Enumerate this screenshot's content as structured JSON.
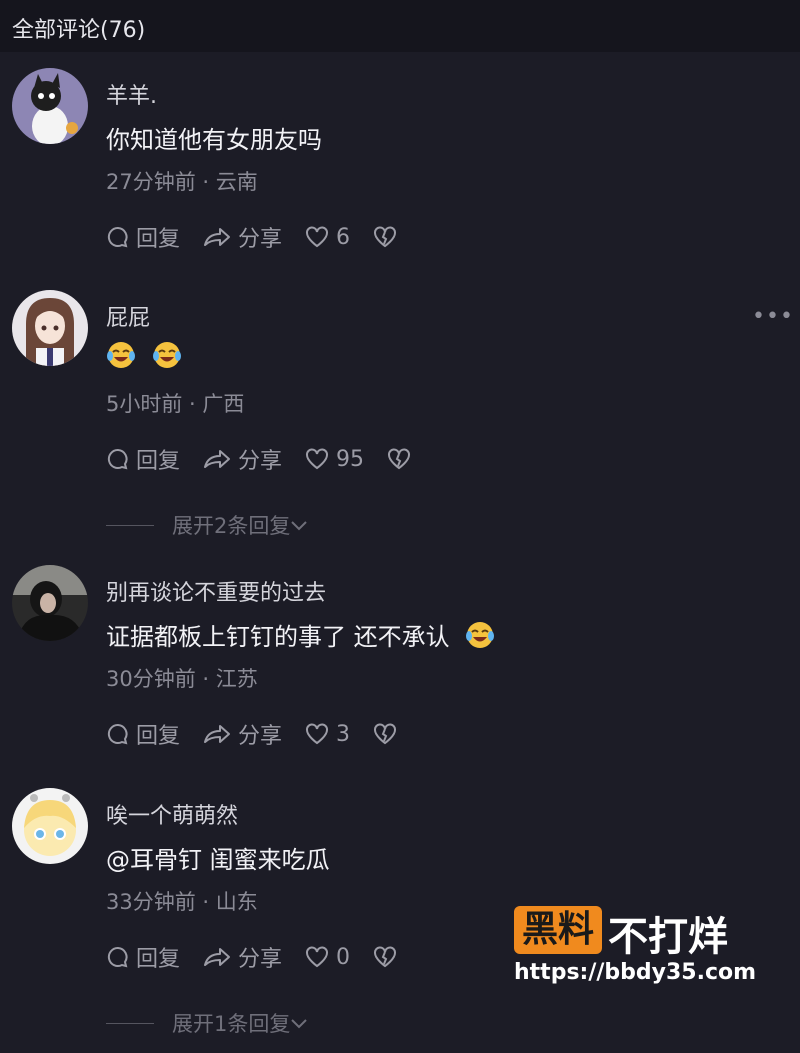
{
  "header": {
    "title": "全部评论(76)"
  },
  "actions_labels": {
    "reply": "回复",
    "share": "分享"
  },
  "comments": [
    {
      "name": "羊羊.",
      "text": "你知道他有女朋友吗",
      "meta": "27分钟前 · 云南",
      "likes": "6",
      "avatar": "cat-cartoon-avatar"
    },
    {
      "name": "屁屁",
      "text": "",
      "emojis": [
        "laugh-cry-emoji",
        "laugh-cry-emoji"
      ],
      "meta": "5小时前 · 广西",
      "likes": "95",
      "more": "•••",
      "expand": "展开2条回复",
      "avatar": "anime-girl-avatar"
    },
    {
      "name": "别再谈论不重要的过去",
      "text": "证据都板上钉钉的事了 还不承认",
      "emojis": [
        "laugh-cry-emoji"
      ],
      "meta": "30分钟前 · 江苏",
      "likes": "3",
      "avatar": "dark-photo-avatar"
    },
    {
      "name": "唉一个萌萌然",
      "text": "@耳骨钉  闺蜜来吃瓜",
      "meta": "33分钟前 · 山东",
      "likes": "0",
      "expand": "展开1条回复",
      "avatar": "chibi-avatar"
    }
  ],
  "watermark": {
    "badge": "黑料",
    "tail": "不打烊",
    "url": "https://bbdy35.com"
  },
  "colors": {
    "background": "#1c1c26",
    "accent": "#f08a1e"
  }
}
